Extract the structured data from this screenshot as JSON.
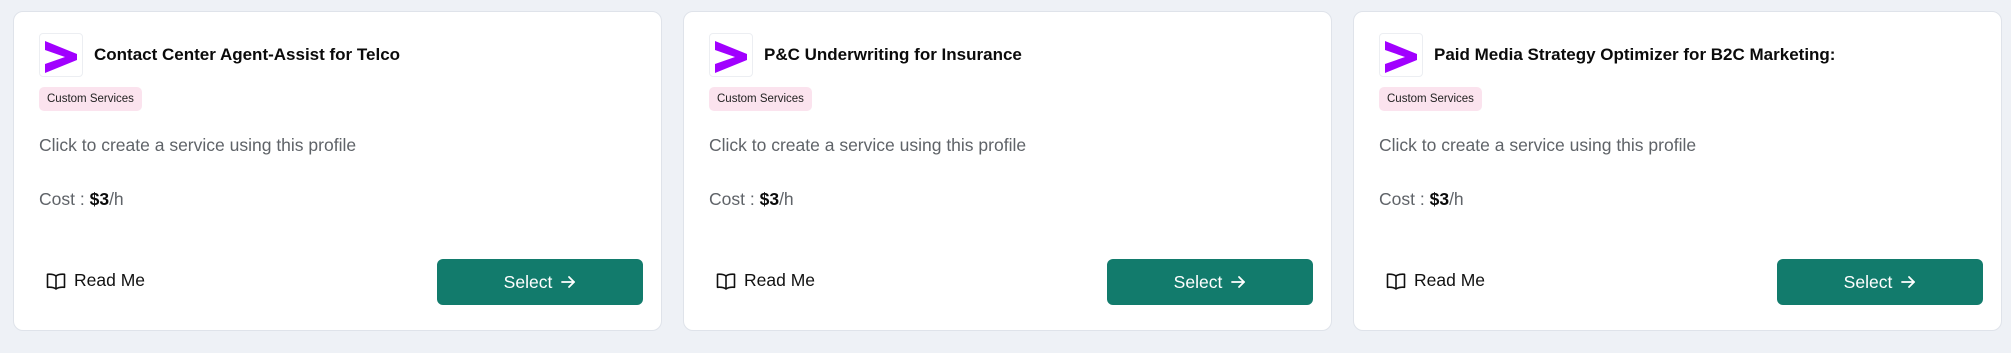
{
  "colors": {
    "background": "#eef1f6",
    "card": "#ffffff",
    "accent_button": "#127b6c",
    "badge_bg": "#fbe3ee",
    "logo_purple": "#a100ff"
  },
  "cards": [
    {
      "logo_icon": "accenture-chevron-icon",
      "title": "Contact Center Agent-Assist for Telco",
      "badge": "Custom Services",
      "description": "Click to create a service using this profile",
      "cost_label": "Cost :",
      "cost_value": "$3",
      "cost_unit": "/h",
      "readme_icon": "book-icon",
      "readme_label": "Read Me",
      "select_label": "Select",
      "select_icon": "arrow-right-icon"
    },
    {
      "logo_icon": "accenture-chevron-icon",
      "title": "P&C Underwriting for Insurance",
      "badge": "Custom Services",
      "description": "Click to create a service using this profile",
      "cost_label": "Cost :",
      "cost_value": "$3",
      "cost_unit": "/h",
      "readme_icon": "book-icon",
      "readme_label": "Read Me",
      "select_label": "Select",
      "select_icon": "arrow-right-icon"
    },
    {
      "logo_icon": "accenture-chevron-icon",
      "title": "Paid Media Strategy Optimizer for B2C Marketing:",
      "badge": "Custom Services",
      "description": "Click to create a service using this profile",
      "cost_label": "Cost :",
      "cost_value": "$3",
      "cost_unit": "/h",
      "readme_icon": "book-icon",
      "readme_label": "Read Me",
      "select_label": "Select",
      "select_icon": "arrow-right-icon"
    }
  ]
}
